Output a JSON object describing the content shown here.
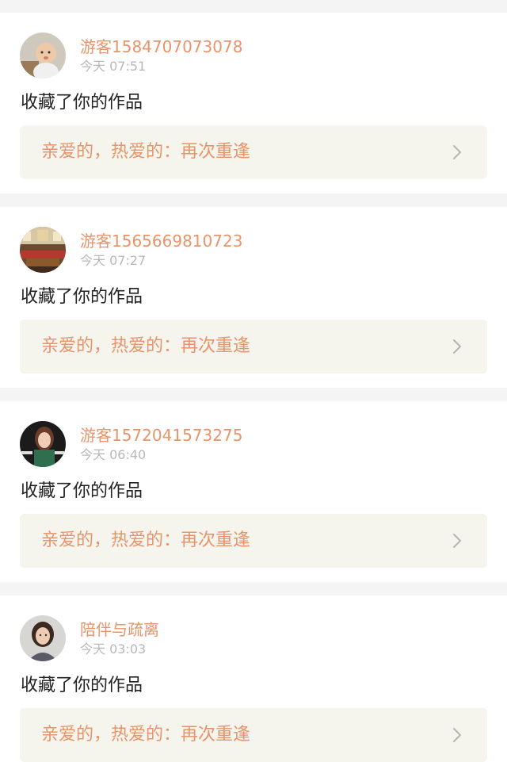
{
  "notifications": [
    {
      "username": "游客1584707073078",
      "time": "今天 07:51",
      "action": "收藏了你的作品",
      "work_title": "亲爱的，热爱的：再次重逢",
      "avatar_icon": "baby-photo-avatar"
    },
    {
      "username": "游客1565669810723",
      "time": "今天 07:27",
      "action": "收藏了你的作品",
      "work_title": "亲爱的，热爱的：再次重逢",
      "avatar_icon": "room-interior-avatar"
    },
    {
      "username": "游客1572041573275",
      "time": "今天 06:40",
      "action": "收藏了你的作品",
      "work_title": "亲爱的，热爱的：再次重逢",
      "avatar_icon": "girl-portrait-avatar"
    },
    {
      "username": "陪伴与疏离",
      "time": "今天 03:03",
      "action": "收藏了你的作品",
      "work_title": "亲爱的，热爱的：再次重逢",
      "avatar_icon": "woman-portrait-avatar"
    }
  ],
  "colors": {
    "accent": "#e8946a",
    "time_gray": "#b8b8b8",
    "card_bg": "#ffffff",
    "page_bg": "#f4f4f4",
    "work_box_bg": "#f5f4ed",
    "chevron": "#b5b5b5"
  }
}
